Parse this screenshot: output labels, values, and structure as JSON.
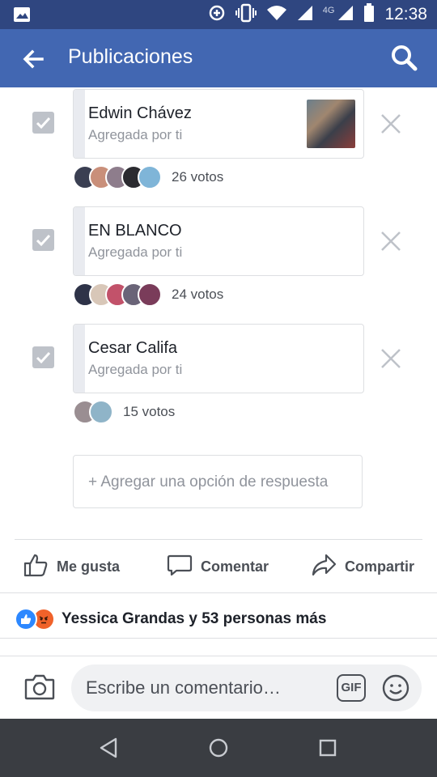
{
  "status_bar": {
    "time": "12:38",
    "network": "4G"
  },
  "app_bar": {
    "title": "Publicaciones"
  },
  "poll": {
    "options": [
      {
        "name": "Edwin Chávez",
        "subtitle": "Agregada por ti",
        "votes_label": "26 votos",
        "checked": true,
        "has_thumbnail": true
      },
      {
        "name": "EN BLANCO",
        "subtitle": "Agregada por ti",
        "votes_label": "24 votos",
        "checked": true,
        "has_thumbnail": false
      },
      {
        "name": "Cesar Califa",
        "subtitle": "Agregada por ti",
        "votes_label": "15 votos",
        "checked": true,
        "has_thumbnail": false
      }
    ],
    "add_option_label": "+ Agregar una opción de respuesta"
  },
  "actions": {
    "like": "Me gusta",
    "comment": "Comentar",
    "share": "Compartir"
  },
  "reactions": {
    "summary": "Yessica Grandas y 53 personas más",
    "icons": [
      "like-icon",
      "angry-icon"
    ]
  },
  "comment_bar": {
    "placeholder": "Escribe un comentario…",
    "gif_label": "GIF"
  },
  "colors": {
    "header": "#4267b2",
    "status_bar": "#2f4680",
    "nav_bar": "#3a3d42",
    "checkbox": "#bec2c9"
  }
}
